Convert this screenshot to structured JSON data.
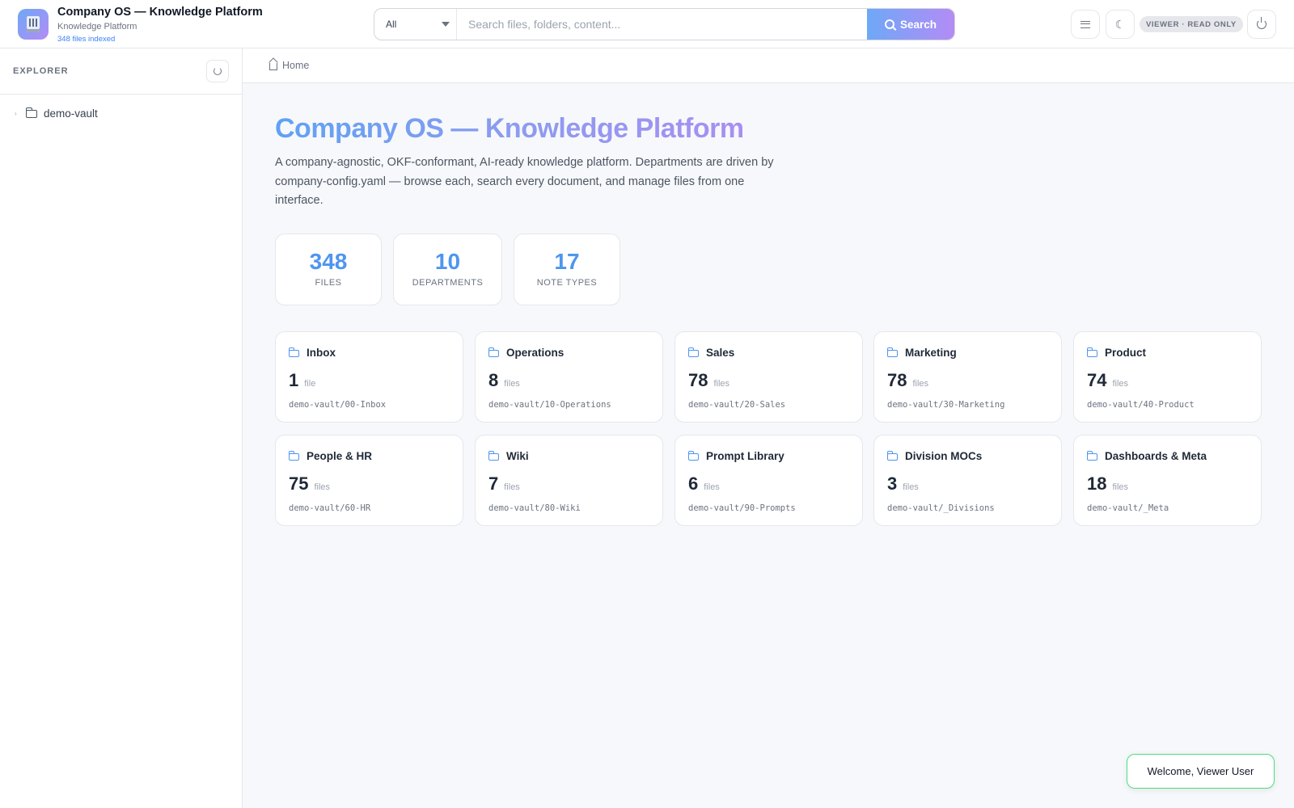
{
  "header": {
    "title": "Company OS — Knowledge Platform",
    "subtitle": "Knowledge Platform",
    "files_indexed": "348 files indexed",
    "search": {
      "scope": "All",
      "placeholder": "Search files, folders, content...",
      "button_label": "Search"
    },
    "role_badge": "VIEWER · READ ONLY",
    "icons": [
      "menu-icon",
      "moon-icon",
      "power-icon"
    ]
  },
  "sidebar": {
    "title": "EXPLORER",
    "tree": [
      {
        "label": "demo-vault"
      }
    ]
  },
  "breadcrumb": {
    "home": "Home"
  },
  "main": {
    "title": "Company OS — Knowledge Platform",
    "description": "A company-agnostic, OKF-conformant, AI-ready knowledge platform. Departments are driven by company-config.yaml — browse each, search every document, and manage files from one interface.",
    "stats": [
      {
        "value": "348",
        "label": "FILES"
      },
      {
        "value": "10",
        "label": "DEPARTMENTS"
      },
      {
        "value": "17",
        "label": "NOTE TYPES"
      }
    ],
    "departments": [
      {
        "name": "Inbox",
        "count": "1",
        "unit": "file",
        "path": "demo-vault/00-Inbox"
      },
      {
        "name": "Operations",
        "count": "8",
        "unit": "files",
        "path": "demo-vault/10-Operations"
      },
      {
        "name": "Sales",
        "count": "78",
        "unit": "files",
        "path": "demo-vault/20-Sales"
      },
      {
        "name": "Marketing",
        "count": "78",
        "unit": "files",
        "path": "demo-vault/30-Marketing"
      },
      {
        "name": "Product",
        "count": "74",
        "unit": "files",
        "path": "demo-vault/40-Product"
      },
      {
        "name": "People & HR",
        "count": "75",
        "unit": "files",
        "path": "demo-vault/60-HR"
      },
      {
        "name": "Wiki",
        "count": "7",
        "unit": "files",
        "path": "demo-vault/80-Wiki"
      },
      {
        "name": "Prompt Library",
        "count": "6",
        "unit": "files",
        "path": "demo-vault/90-Prompts"
      },
      {
        "name": "Division MOCs",
        "count": "3",
        "unit": "files",
        "path": "demo-vault/_Divisions"
      },
      {
        "name": "Dashboards & Meta",
        "count": "18",
        "unit": "files",
        "path": "demo-vault/_Meta"
      }
    ]
  },
  "toast": "Welcome, Viewer User",
  "colors": {
    "accent": "#4f95ef",
    "gradient_start": "#6ea8f7",
    "gradient_end": "#b38cf5",
    "toast_border": "#4ade80"
  }
}
